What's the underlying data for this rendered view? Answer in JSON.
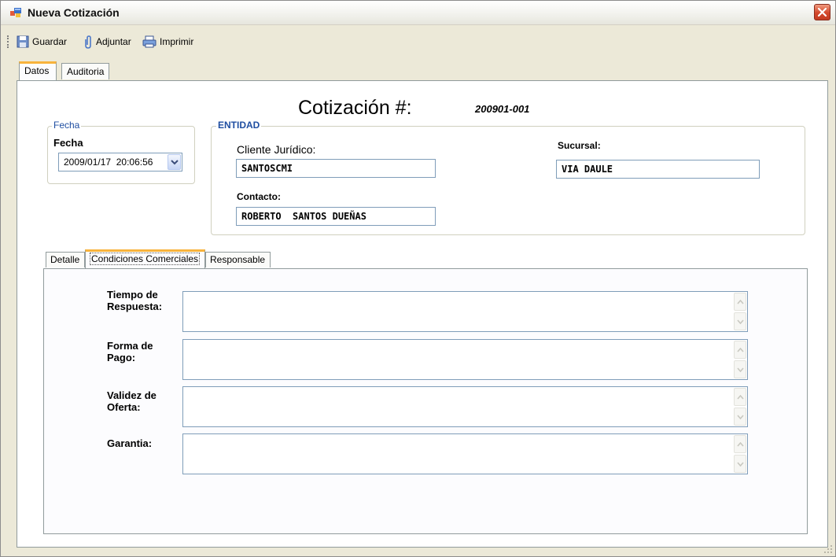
{
  "window": {
    "title": "Nueva Cotización"
  },
  "toolbar": {
    "save_label": "Guardar",
    "attach_label": "Adjuntar",
    "print_label": "Imprimir"
  },
  "outer_tabs": [
    {
      "label": "Datos",
      "active": true
    },
    {
      "label": "Auditoria",
      "active": false
    }
  ],
  "header": {
    "title": "Cotización #:",
    "number": "200901-001"
  },
  "fecha_group": {
    "legend": "Fecha",
    "label": "Fecha",
    "value": "2009/01/17  20:06:56"
  },
  "entidad_group": {
    "legend": "ENTIDAD",
    "cliente_label": "Cliente Jurídico:",
    "cliente_value": "SANTOSCMI",
    "sucursal_label": "Sucursal:",
    "sucursal_value": "VIA DAULE",
    "contacto_label": "Contacto:",
    "contacto_value": "ROBERTO  SANTOS DUEÑAS"
  },
  "inner_tabs": [
    {
      "label": "Detalle",
      "active": false
    },
    {
      "label": "Condiciones Comerciales",
      "active": true
    },
    {
      "label": "Responsable",
      "active": false
    }
  ],
  "conditions": [
    {
      "label_line1": "Tiempo de",
      "label_line2": "Respuesta:",
      "value": ""
    },
    {
      "label_line1": "Forma de",
      "label_line2": "Pago:",
      "value": ""
    },
    {
      "label_line1": "Validez de",
      "label_line2": "Oferta:",
      "value": ""
    },
    {
      "label_line1": "Garantia:",
      "label_line2": "",
      "value": ""
    }
  ],
  "colors": {
    "accent_tab": "#f8b33c",
    "group_legend": "#1f4ea1",
    "close": "#d3472a"
  },
  "icons": {
    "app": "app-icon",
    "close": "close-icon",
    "save": "floppy-disk-icon",
    "attach": "paperclip-icon",
    "print": "printer-icon",
    "dropdown": "chevron-down-icon"
  }
}
